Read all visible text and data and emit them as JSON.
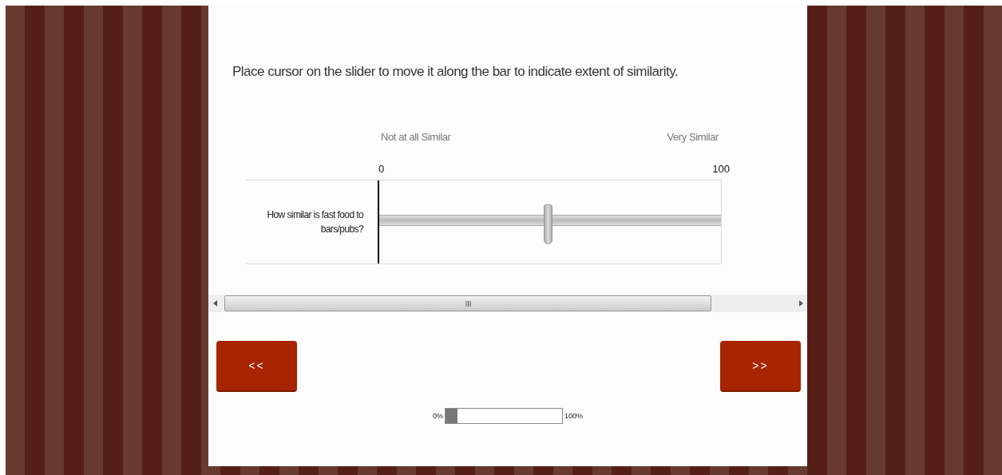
{
  "instruction": "Place cursor on the slider to move it along the bar to indicate extent of similarity.",
  "scale": {
    "left_label": "Not at all Similar",
    "right_label": "Very Similar",
    "min": "0",
    "max": "100"
  },
  "question": {
    "text": "How similar is fast food to bars/pubs?",
    "level": 0.49
  },
  "buttons": {
    "back": "<<",
    "next": ">>"
  },
  "progress": {
    "start": "0%",
    "end": "100%",
    "level": 0.1
  }
}
